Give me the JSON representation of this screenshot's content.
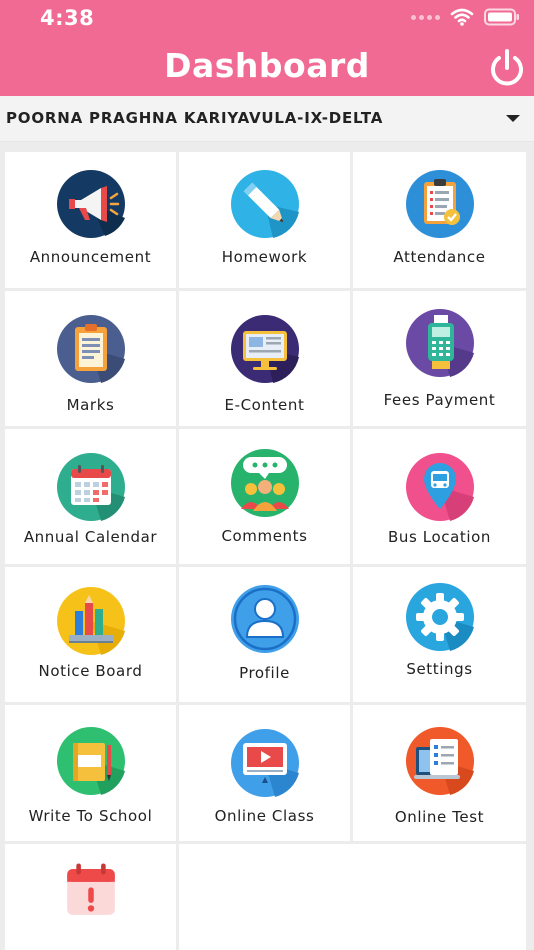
{
  "status_bar": {
    "time": "4:38"
  },
  "header": {
    "title": "Dashboard"
  },
  "student_selector": {
    "selected": "POORNA PRAGHNA KARIYAVULA-IX-DELTA"
  },
  "tiles": [
    {
      "label": "Announcement",
      "icon": "megaphone-icon"
    },
    {
      "label": "Homework",
      "icon": "pencil-icon"
    },
    {
      "label": "Attendance",
      "icon": "clipboard-check-icon"
    },
    {
      "label": "Marks",
      "icon": "report-card-icon"
    },
    {
      "label": "E-Content",
      "icon": "monitor-icon"
    },
    {
      "label": "Fees Payment",
      "icon": "card-machine-icon"
    },
    {
      "label": "Annual Calendar",
      "icon": "calendar-icon"
    },
    {
      "label": "Comments",
      "icon": "chat-group-icon"
    },
    {
      "label": "Bus Location",
      "icon": "bus-pin-icon"
    },
    {
      "label": "Notice Board",
      "icon": "notice-board-icon"
    },
    {
      "label": "Profile",
      "icon": "user-icon"
    },
    {
      "label": "Settings",
      "icon": "gear-icon"
    },
    {
      "label": "Write To School",
      "icon": "notebook-icon"
    },
    {
      "label": "Online Class",
      "icon": "video-lesson-icon"
    },
    {
      "label": "Online Test",
      "icon": "test-paper-icon"
    },
    {
      "label": "",
      "icon": "calendar-alert-icon"
    }
  ],
  "colors": {
    "header": "#f06a93",
    "grid_background": "#ececec",
    "tile": "#ffffff"
  }
}
